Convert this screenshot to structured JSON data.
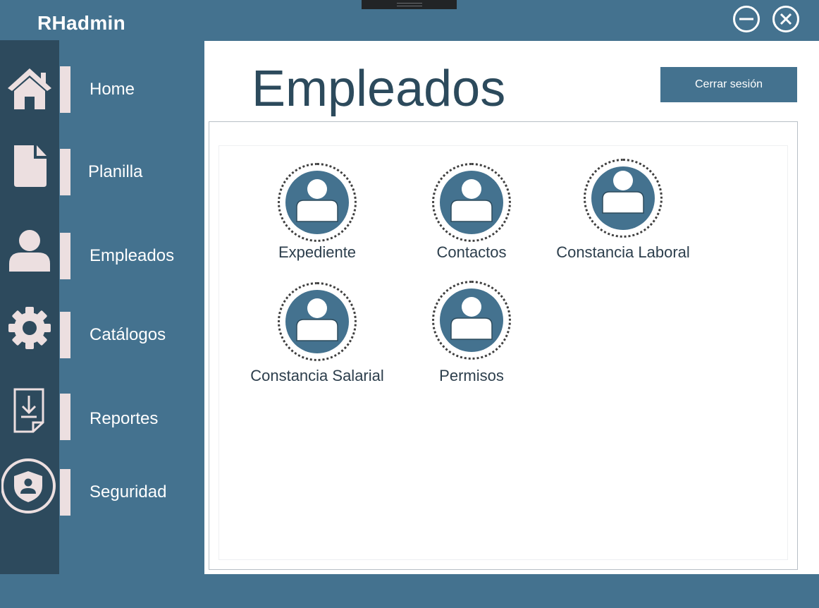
{
  "window": {
    "app_title": "RHadmin",
    "minimize_icon": "minimize-circle-icon",
    "close_icon": "close-circle-icon"
  },
  "colors": {
    "accent": "#44728f",
    "rail": "#2d4a5d",
    "nav_marker": "#ecdfe0",
    "title_text": "#2c4a5c"
  },
  "sidebar": {
    "items": [
      {
        "label": "Home",
        "icon": "home-icon"
      },
      {
        "label": "Planilla",
        "icon": "document-icon"
      },
      {
        "label": "Empleados",
        "icon": "user-icon"
      },
      {
        "label": "Catálogos",
        "icon": "gear-icon"
      },
      {
        "label": "Reportes",
        "icon": "download-report-icon"
      },
      {
        "label": "Seguridad",
        "icon": "shield-user-icon"
      }
    ]
  },
  "main": {
    "title": "Empleados",
    "logout_label": "Cerrar sesión",
    "tiles": [
      {
        "label": "Expediente",
        "icon": "user-avatar-icon"
      },
      {
        "label": "Contactos",
        "icon": "user-avatar-icon"
      },
      {
        "label": "Constancia Laboral",
        "icon": "user-avatar-icon"
      },
      {
        "label": "Constancia Salarial",
        "icon": "user-avatar-icon"
      },
      {
        "label": "Permisos",
        "icon": "user-avatar-icon"
      }
    ]
  }
}
